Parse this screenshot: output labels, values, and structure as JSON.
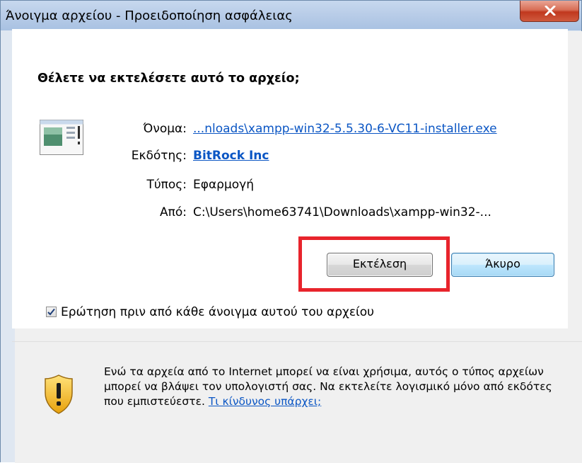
{
  "window": {
    "title": "Άνοιγμα αρχείου - Προειδοποίηση ασφάλειας",
    "close_icon": "close-x-icon"
  },
  "prompt": {
    "question": "Θέλετε να εκτελέσετε αυτό το αρχείο;"
  },
  "file": {
    "icon": "application-window-icon",
    "name_label": "Όνομα:",
    "name_value": "...nloads\\xampp-win32-5.5.30-6-VC11-installer.exe",
    "publisher_label": "Εκδότης:",
    "publisher_value": "BitRock Inc",
    "type_label": "Τύπος:",
    "type_value": "Εφαρμογή",
    "from_label": "Από:",
    "from_value": "C:\\Users\\home63741\\Downloads\\xampp-win32-..."
  },
  "buttons": {
    "run": "Εκτέλεση",
    "cancel": "Άκυρο"
  },
  "checkbox": {
    "label": "Ερώτηση πριν από κάθε άνοιγμα αυτού του αρχείου",
    "checked": true
  },
  "warning": {
    "icon": "security-shield-icon",
    "text": "Ενώ τα αρχεία από το Internet μπορεί να είναι χρήσιμα, αυτός ο τύπος αρχείων μπορεί να βλάψει τον υπολογιστή σας. Να εκτελείτε λογισμικό μόνο από εκδότες που εμπιστεύεστε.",
    "link": "Τι κίνδυνος υπάρχει;"
  },
  "colors": {
    "highlight": "#e8242c",
    "link": "#0b56c4"
  }
}
